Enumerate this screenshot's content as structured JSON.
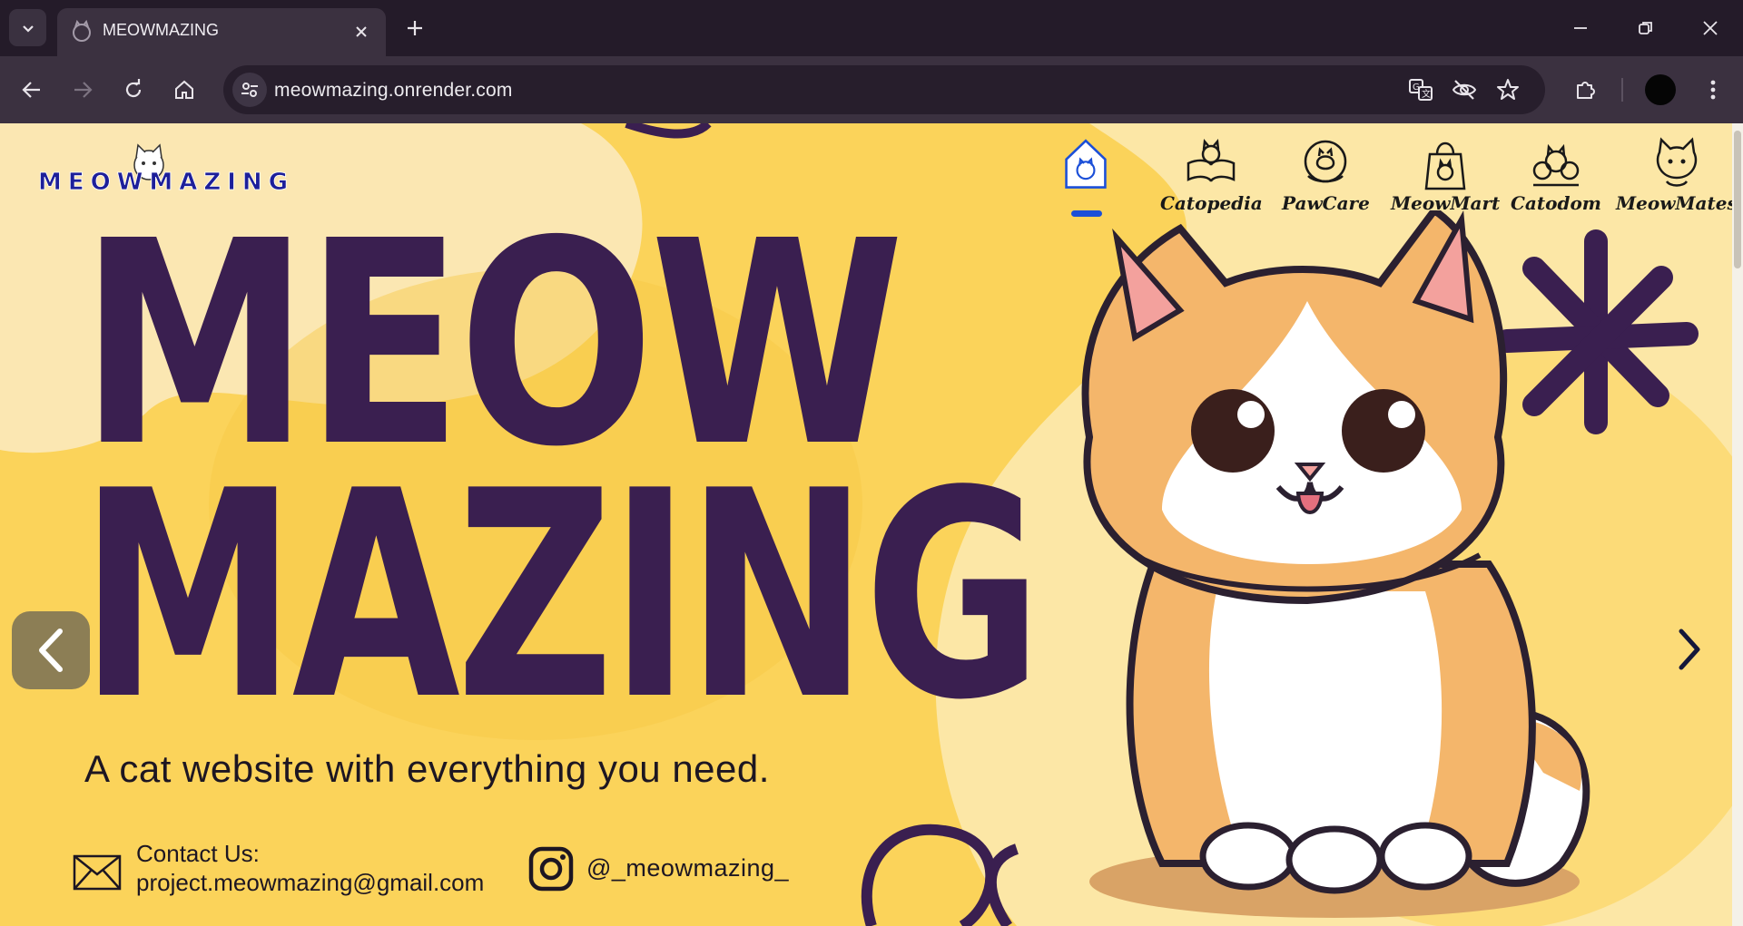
{
  "browser": {
    "tab_title": "MEOWMAZING",
    "url": "meowmazing.onrender.com"
  },
  "icons": {
    "tab_list": "chevron-down-icon",
    "favicon": "cat-favicon-icon",
    "tab_close": "close-icon",
    "new_tab": "plus-icon",
    "minimize": "minimize-icon",
    "restore": "restore-icon",
    "close_window": "close-icon",
    "back": "arrow-left-icon",
    "forward": "arrow-right-icon",
    "reload": "reload-icon",
    "home": "home-icon",
    "site_info": "tune-icon",
    "translate": "translate-icon",
    "tracking": "eye-off-icon",
    "bookmark": "star-icon",
    "extensions": "puzzle-icon",
    "menu": "kebab-menu-icon"
  },
  "site": {
    "logo_text": "MEOWMAZING",
    "nav": [
      {
        "label": "",
        "icon": "house-cat-icon",
        "active": true
      },
      {
        "label": "Catopedia",
        "icon": "cat-book-icon"
      },
      {
        "label": "PawCare",
        "icon": "cat-care-icon"
      },
      {
        "label": "MeowMart",
        "icon": "shopping-bag-icon"
      },
      {
        "label": "Catodom",
        "icon": "cat-family-icon"
      },
      {
        "label": "MeowMates",
        "icon": "cat-face-icon"
      }
    ],
    "hero": {
      "line1": "MEOW",
      "line2": "MAZING",
      "tagline": "A cat website with everything you need."
    },
    "contact": {
      "title": "Contact Us:",
      "email": "project.meowmazing@gmail.com",
      "instagram": "@_meowmazing_"
    },
    "colors": {
      "background": "#fbd35a",
      "headline": "#3a1f50",
      "accent": "#1b4fd8"
    }
  }
}
